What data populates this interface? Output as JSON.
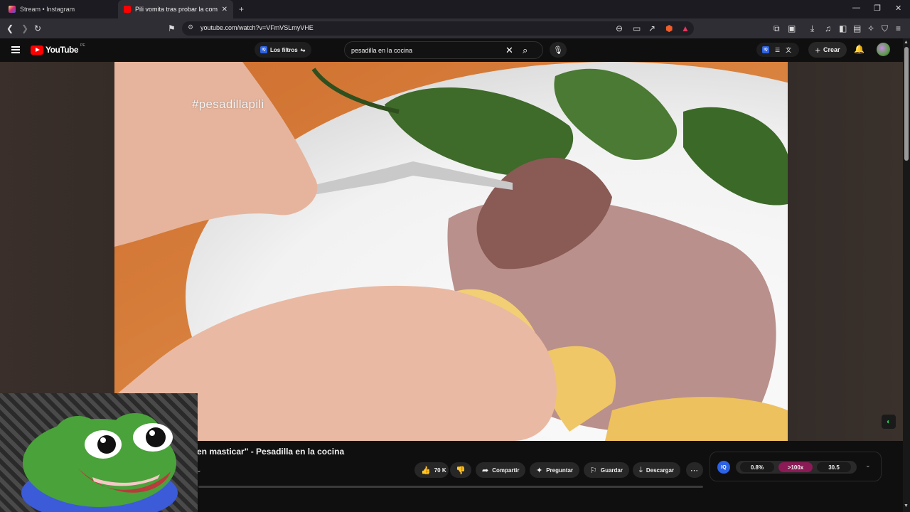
{
  "browser": {
    "tabs": [
      {
        "title": "Stream • Instagram",
        "favicon_color": "#c13584"
      },
      {
        "title": "Pili vomita tras probar la comida",
        "favicon_color": "#ff0000"
      }
    ],
    "url": "youtube.com/watch?v=VFmVSLmyVHE"
  },
  "youtube": {
    "logo_text": "YouTube",
    "country_code": "PE",
    "filters_label": "Los filtros",
    "filters_badge": "IQ",
    "search_query": "pesadilla en la cocina",
    "create_label": "Crear"
  },
  "video": {
    "overlay_text": "#pesadillapili"
  },
  "below": {
    "title": "en masticar\" - Pesadilla en la cocina",
    "like_count": "70 K",
    "actions": {
      "share": "Compartir",
      "ask": "Preguntar",
      "save": "Guardar",
      "download": "Descargar"
    }
  },
  "stats_widget": {
    "badge": "IQ",
    "values": [
      "0.8%",
      ">100x",
      "30.5"
    ],
    "highlight_color": "#8b1a56"
  }
}
